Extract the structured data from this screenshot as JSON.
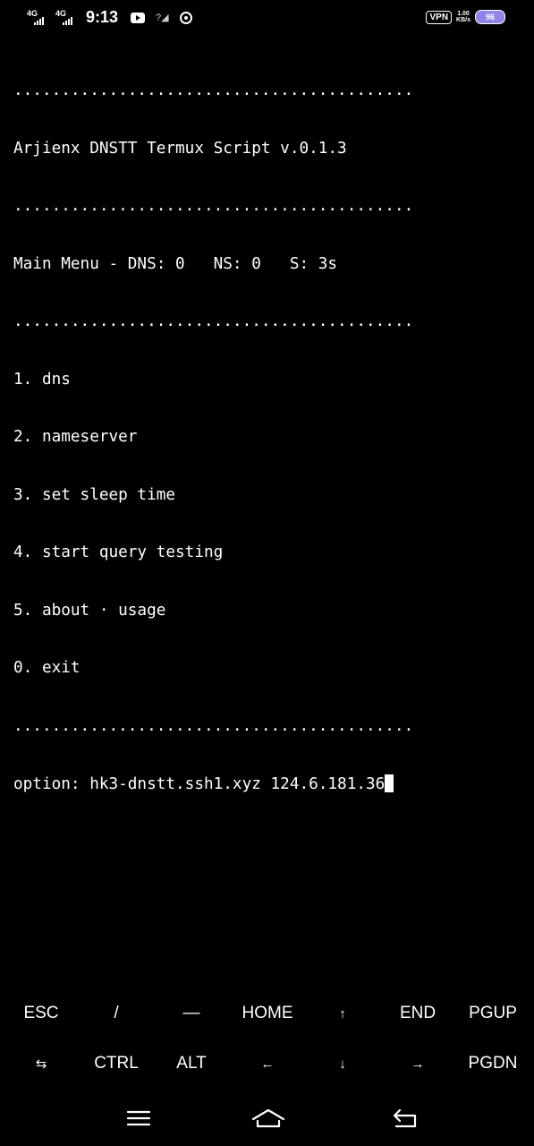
{
  "status_bar": {
    "network_1": "4G",
    "network_2": "4G",
    "time": "9:13",
    "vpn": "VPN",
    "speed_value": "1.00",
    "speed_unit": "KB/s",
    "battery": "96",
    "icons": [
      "signal-icon",
      "signal-icon",
      "youtube-icon",
      "no-signal-icon",
      "chrome-icon",
      "vpn-icon",
      "battery-icon"
    ]
  },
  "terminal": {
    "lines": [
      "..........................................",
      "Arjienx DNSTT Termux Script v.0.1.3",
      "..........................................",
      "Main Menu - DNS: 0   NS: 0   S: 3s",
      "..........................................",
      "1. dns",
      "2. nameserver",
      "3. set sleep time",
      "4. start query testing",
      "5. about · usage",
      "0. exit",
      ".........................................."
    ],
    "prompt": "option: hk3-dnstt.ssh1.xyz 124.6.181.36"
  },
  "extra_keys": {
    "row1": [
      "ESC",
      "/",
      "—",
      "HOME",
      "↑",
      "END",
      "PGUP"
    ],
    "row2": [
      "⇆",
      "CTRL",
      "ALT",
      "←",
      "↓",
      "→",
      "PGDN"
    ]
  },
  "nav_bar": {
    "icons": [
      "menu-icon",
      "home-icon",
      "back-icon"
    ]
  }
}
